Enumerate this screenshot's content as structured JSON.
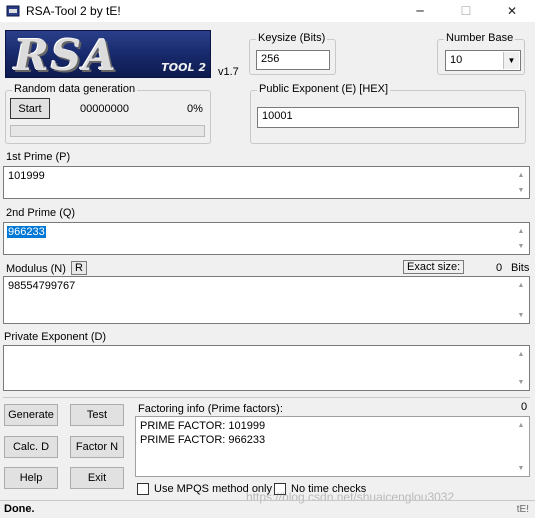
{
  "window": {
    "title": "RSA-Tool 2 by tE!",
    "minimize_glyph": "─",
    "maximize_glyph": "☐",
    "close_glyph": "✕"
  },
  "logo": {
    "main_text": "RSA",
    "sub_text": "TOOL 2"
  },
  "version": "v1.7",
  "keysize": {
    "label": "Keysize (Bits)",
    "value": "256"
  },
  "number_base": {
    "label": "Number Base",
    "selected": "10"
  },
  "random": {
    "label": "Random data generation",
    "start_button": "Start",
    "counter": "00000000",
    "percent": "0%",
    "progress": 0
  },
  "public_exponent": {
    "label": "Public Exponent (E) [HEX]",
    "value": "10001"
  },
  "prime1": {
    "label": "1st Prime (P)",
    "value": "101999"
  },
  "prime2": {
    "label": "2nd Prime (Q)",
    "value": "966233"
  },
  "modulus": {
    "label": "Modulus (N)",
    "r_button": "R",
    "exact_size_label": "Exact size:",
    "exact_size_value": "0",
    "exact_size_unit": "Bits",
    "value": "98554799767"
  },
  "private_exponent": {
    "label": "Private Exponent (D)",
    "value": ""
  },
  "buttons": {
    "generate": "Generate",
    "test": "Test",
    "calc_d": "Calc. D",
    "factor_n": "Factor N",
    "help": "Help",
    "exit": "Exit"
  },
  "factoring": {
    "label": "Factoring info (Prime factors):",
    "count": "0",
    "lines": [
      "PRIME FACTOR: 101999",
      "PRIME FACTOR: 966233"
    ]
  },
  "options": {
    "mpqs_label": "Use MPQS method only",
    "mpqs_checked": false,
    "no_time_label": "No time checks",
    "no_time_checked": false
  },
  "status": {
    "text": "Done.",
    "tag": "tE!"
  },
  "watermark": "https://blog.csdn.net/shuaicenglou3032",
  "colors": {
    "selection": "#0078d7",
    "logo_bg": "#17286a"
  }
}
